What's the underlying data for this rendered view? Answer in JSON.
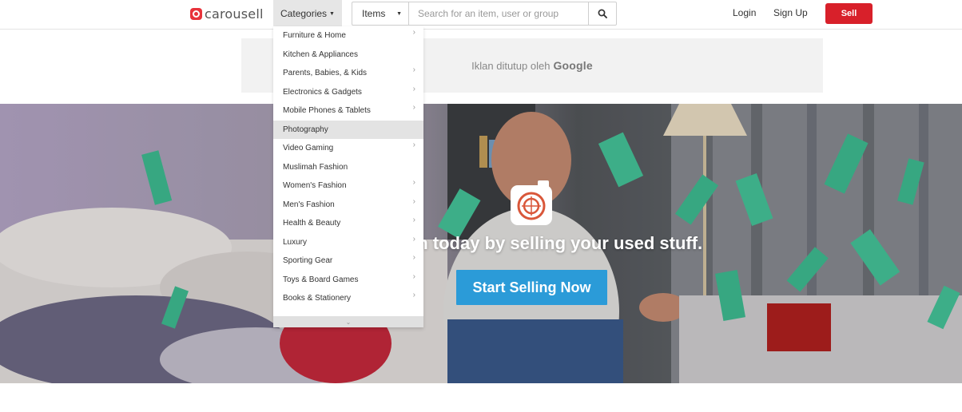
{
  "brand": {
    "name": "carousell"
  },
  "header": {
    "categories_label": "Categories",
    "search_type": "Items",
    "search_placeholder": "Search for an item, user or group",
    "login": "Login",
    "signup": "Sign Up",
    "sell": "Sell"
  },
  "ad": {
    "label": "Iklan ditutup oleh",
    "provider": "Google"
  },
  "hero": {
    "tagline": "sh today by selling your used stuff.",
    "cta": "Start Selling Now"
  },
  "dropdown": {
    "items": [
      {
        "label": "Furniture & Home",
        "has_sub": true
      },
      {
        "label": "Kitchen & Appliances",
        "has_sub": false
      },
      {
        "label": "Parents, Babies, & Kids",
        "has_sub": true
      },
      {
        "label": "Electronics & Gadgets",
        "has_sub": true
      },
      {
        "label": "Mobile Phones & Tablets",
        "has_sub": true
      },
      {
        "label": "Photography",
        "has_sub": false,
        "active": true
      },
      {
        "label": "Video Gaming",
        "has_sub": true
      },
      {
        "label": "Muslimah Fashion",
        "has_sub": false
      },
      {
        "label": "Women's Fashion",
        "has_sub": true
      },
      {
        "label": "Men's Fashion",
        "has_sub": true
      },
      {
        "label": "Health & Beauty",
        "has_sub": true
      },
      {
        "label": "Luxury",
        "has_sub": true
      },
      {
        "label": "Sporting Gear",
        "has_sub": true
      },
      {
        "label": "Toys & Board Games",
        "has_sub": true
      },
      {
        "label": "Books & Stationery",
        "has_sub": true
      }
    ]
  },
  "colors": {
    "sell_button": "#d8202a",
    "cta_button": "#2b9bd8",
    "brand_red": "#e8333b",
    "money_green": "#3fbf93"
  }
}
